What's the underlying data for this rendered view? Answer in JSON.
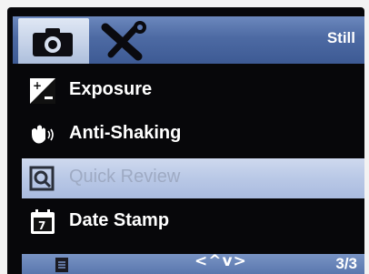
{
  "header": {
    "tabs": [
      {
        "icon": "camera-icon",
        "active": true
      },
      {
        "icon": "tools-icon",
        "active": false
      }
    ],
    "mode_label": "Still"
  },
  "menu": {
    "items": [
      {
        "icon": "exposure-icon",
        "label": "Exposure",
        "selected": false
      },
      {
        "icon": "hand-shake-icon",
        "label": "Anti-Shaking",
        "selected": false
      },
      {
        "icon": "magnifier-review-icon",
        "label": "Quick Review",
        "selected": true
      },
      {
        "icon": "calendar-icon",
        "label": "Date Stamp",
        "selected": false
      }
    ]
  },
  "footer": {
    "page_icon": "page-icon",
    "nav_arrows": "<^v>",
    "page_count": "3/3"
  },
  "colors": {
    "bar_blue": "#4d6aa3",
    "selected_bg": "#b9c8e6",
    "selected_text": "#9eaac3",
    "screen_bg": "#07070a"
  }
}
